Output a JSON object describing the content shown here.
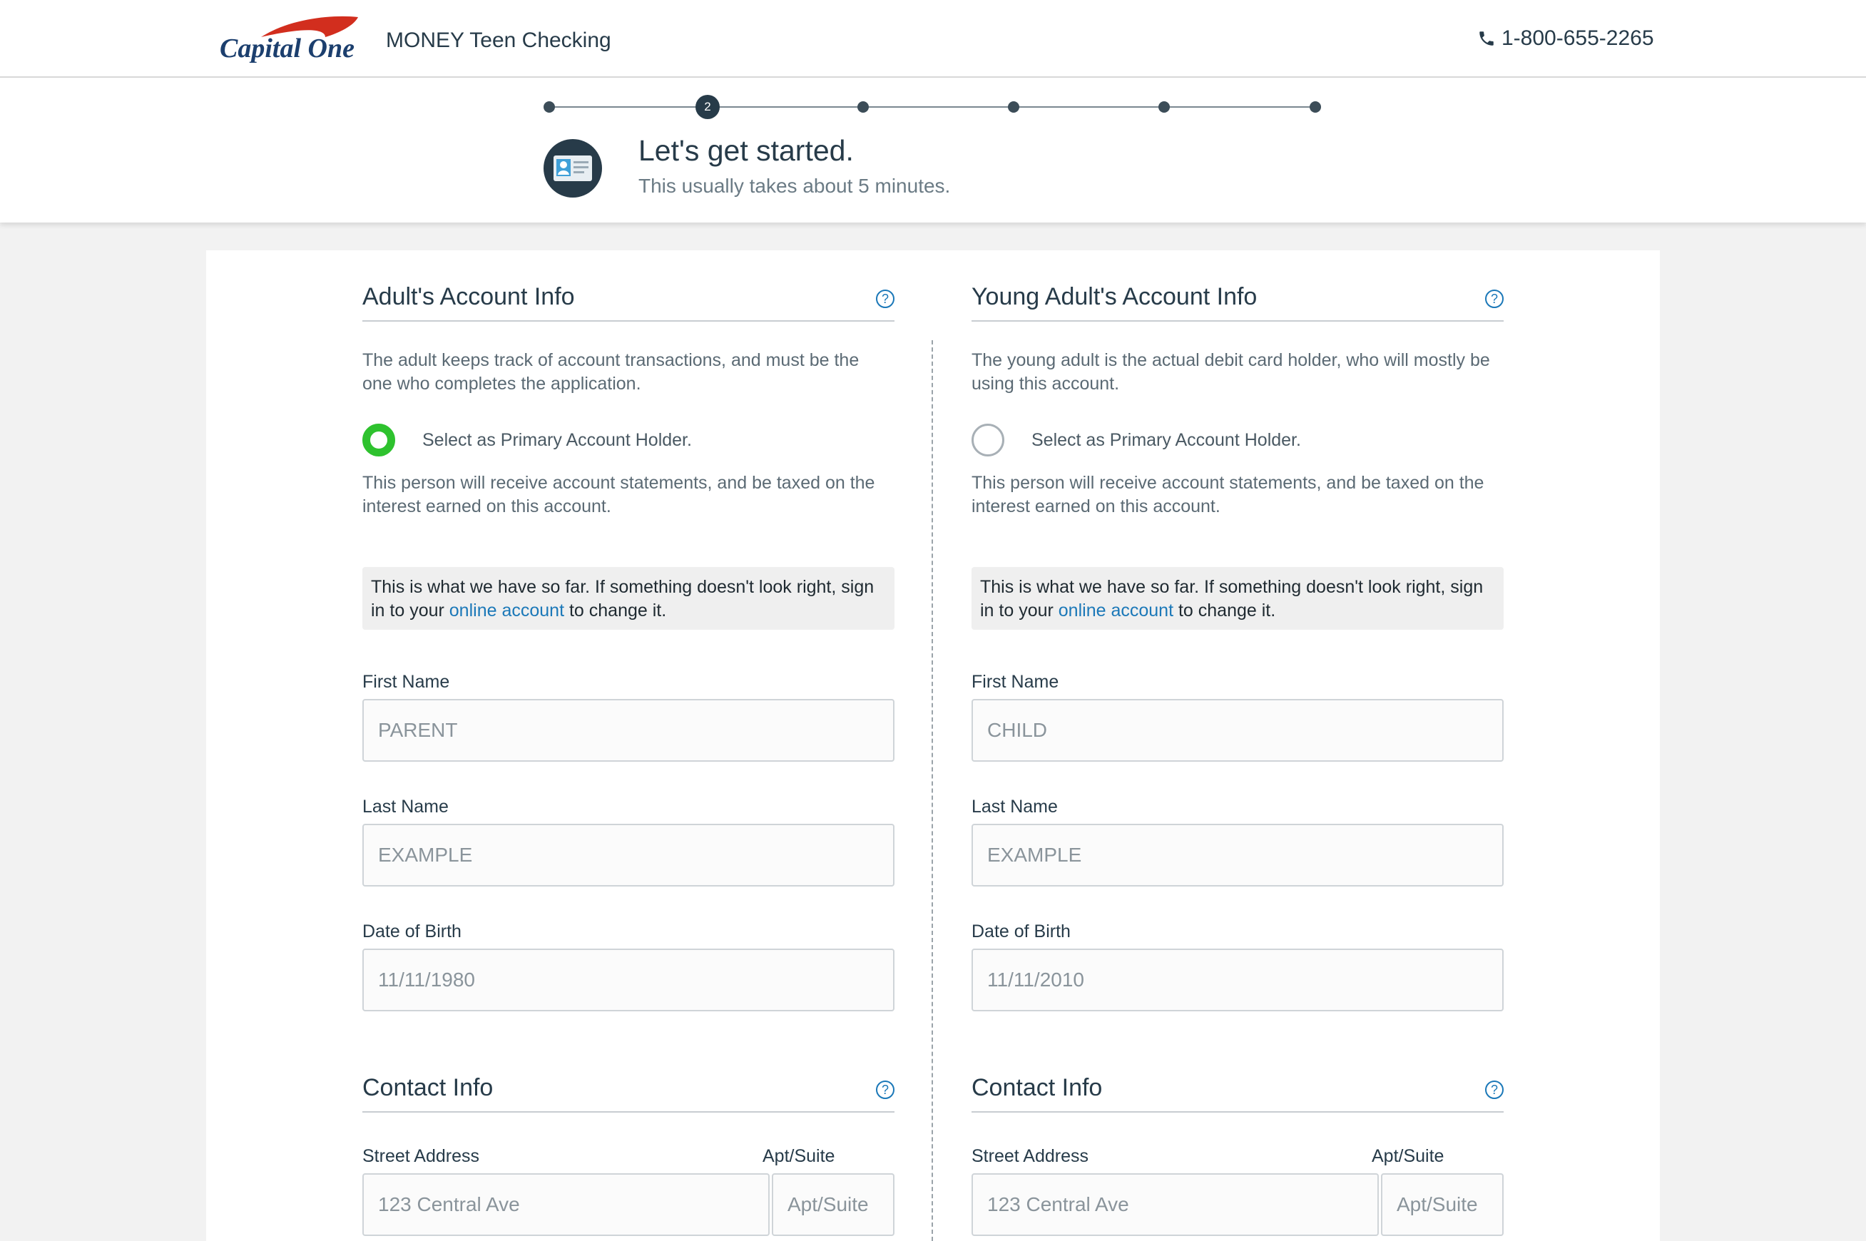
{
  "header": {
    "logo_text": "Capital One",
    "product_title": "MONEY Teen Checking",
    "phone": "1-800-655-2265"
  },
  "stepper": {
    "current_step": "2",
    "total_steps": 6,
    "title": "Let's get started.",
    "subtitle": "This usually takes about 5 minutes."
  },
  "left": {
    "section_title": "Adult's Account Info",
    "description": "The adult keeps track of account transactions, and must be the one who completes the application.",
    "radio_label": "Select as Primary Account Holder.",
    "radio_selected": true,
    "radio_note": "This person will receive account statements, and be taxed on the interest earned on this account.",
    "notice_pre": "This is what we have so far. If something doesn't look right, sign in to your ",
    "notice_link": "online account",
    "notice_post": " to change it.",
    "first_name_label": "First Name",
    "first_name_placeholder": "PARENT",
    "last_name_label": "Last Name",
    "last_name_placeholder": "EXAMPLE",
    "dob_label": "Date of Birth",
    "dob_placeholder": "11/11/1980",
    "contact_title": "Contact Info",
    "street_label": "Street Address",
    "street_placeholder": "123 Central Ave",
    "apt_label": "Apt/Suite",
    "apt_placeholder": "Apt/Suite"
  },
  "right": {
    "section_title": "Young Adult's Account Info",
    "description": "The young adult is the actual debit card holder, who will mostly be using this account.",
    "radio_label": "Select as Primary Account Holder.",
    "radio_selected": false,
    "radio_note": "This person will receive account statements, and be taxed on the interest earned on this account.",
    "notice_pre": "This is what we have so far. If something doesn't look right, sign in to your ",
    "notice_link": "online account",
    "notice_post": " to change it.",
    "first_name_label": "First Name",
    "first_name_placeholder": "CHILD",
    "last_name_label": "Last Name",
    "last_name_placeholder": "EXAMPLE",
    "dob_label": "Date of Birth",
    "dob_placeholder": "11/11/2010",
    "contact_title": "Contact Info",
    "street_label": "Street Address",
    "street_placeholder": "123 Central Ave",
    "apt_label": "Apt/Suite",
    "apt_placeholder": "Apt/Suite"
  },
  "colors": {
    "brand_navy": "#273b49",
    "brand_red": "#d22e1e",
    "selected_green": "#2ec22e",
    "link_blue": "#1b78b8"
  }
}
